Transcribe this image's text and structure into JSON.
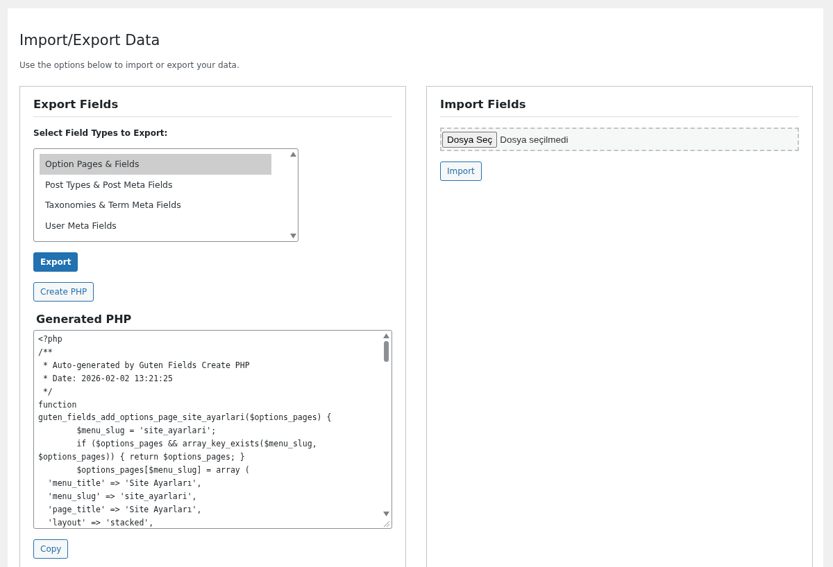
{
  "page": {
    "title": "Import/Export Data",
    "description": "Use the options below to import or export your data."
  },
  "export": {
    "title": "Export Fields",
    "select_label": "Select Field Types to Export:",
    "options": [
      {
        "label": "Option Pages & Fields",
        "selected": true
      },
      {
        "label": "Post Types & Post Meta Fields",
        "selected": false
      },
      {
        "label": "Taxonomies & Term Meta Fields",
        "selected": false
      },
      {
        "label": "User Meta Fields",
        "selected": false
      }
    ],
    "export_button": "Export",
    "create_button": "Create PHP",
    "generated_title": "Generated PHP",
    "code_lines": [
      "<?php",
      "/**",
      " * Auto-generated by Guten Fields Create PHP",
      " * Date: 2026-02-02 13:21:25",
      " */",
      "function",
      "guten_fields_add_options_page_site_ayarlari($options_pages) {",
      "        $menu_slug = 'site_ayarlari';",
      "        if ($options_pages && array_key_exists($menu_slug,",
      "$options_pages)) { return $options_pages; }",
      "        $options_pages[$menu_slug] = array (",
      "  'menu_title' => 'Site Ayarları',",
      "  'menu_slug' => 'site_ayarlari',",
      "  'page_title' => 'Site Ayarları',",
      "  'layout' => 'stacked',"
    ],
    "copy_button": "Copy"
  },
  "import": {
    "title": "Import Fields",
    "file_button": "Dosya Seç",
    "file_status": "Dosya seçilmedi",
    "import_button": "Import"
  }
}
